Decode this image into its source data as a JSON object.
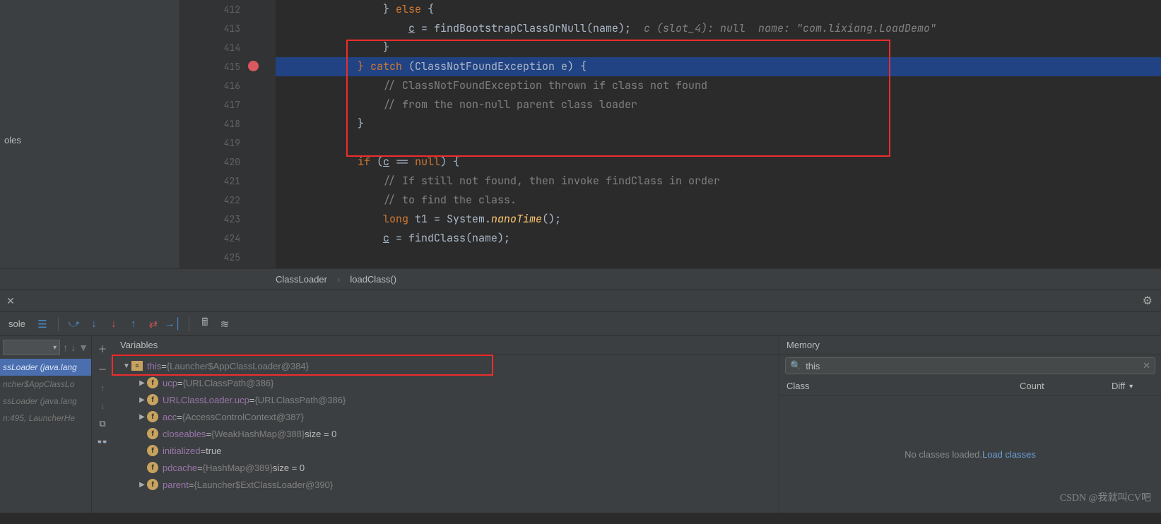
{
  "sidebar": {
    "item": "oles"
  },
  "code": {
    "lines": [
      {
        "n": 412,
        "indent": "                ",
        "tokens": [
          {
            "t": "} ",
            "c": "var"
          },
          {
            "t": "else ",
            "c": "kw"
          },
          {
            "t": "{",
            "c": "var"
          }
        ]
      },
      {
        "n": 413,
        "indent": "                    ",
        "tokens": [
          {
            "t": "c",
            "c": "var underline"
          },
          {
            "t": " = findBootstrapClassOrNull(name);  ",
            "c": "var"
          },
          {
            "t": "c (slot_4): null  name: \"com.lixiang.LoadDemo\"",
            "c": "ide-hint"
          }
        ]
      },
      {
        "n": 414,
        "indent": "                ",
        "tokens": [
          {
            "t": "}",
            "c": "var"
          }
        ]
      },
      {
        "n": 415,
        "indent": "            ",
        "hl": true,
        "bp": true,
        "tokens": [
          {
            "t": "} ",
            "c": "kw"
          },
          {
            "t": "catch ",
            "c": "kw"
          },
          {
            "t": "(ClassNotFoundException e) {",
            "c": "var"
          }
        ]
      },
      {
        "n": 416,
        "indent": "                ",
        "tokens": [
          {
            "t": "// ClassNotFoundException thrown if class not found",
            "c": "cmt"
          }
        ]
      },
      {
        "n": 417,
        "indent": "                ",
        "tokens": [
          {
            "t": "// from the non-null parent class loader",
            "c": "cmt"
          }
        ]
      },
      {
        "n": 418,
        "indent": "            ",
        "tokens": [
          {
            "t": "}",
            "c": "var"
          }
        ]
      },
      {
        "n": 419,
        "indent": "",
        "tokens": []
      },
      {
        "n": 420,
        "indent": "            ",
        "tokens": [
          {
            "t": "if ",
            "c": "kw"
          },
          {
            "t": "(",
            "c": "var"
          },
          {
            "t": "c",
            "c": "var underline"
          },
          {
            "t": " == ",
            "c": "var"
          },
          {
            "t": "null",
            "c": "kw"
          },
          {
            "t": ") {",
            "c": "var"
          }
        ]
      },
      {
        "n": 421,
        "indent": "                ",
        "tokens": [
          {
            "t": "// If still not found, then invoke findClass in order",
            "c": "cmt"
          }
        ]
      },
      {
        "n": 422,
        "indent": "                ",
        "tokens": [
          {
            "t": "// to find the class.",
            "c": "cmt"
          }
        ]
      },
      {
        "n": 423,
        "indent": "                ",
        "tokens": [
          {
            "t": "long ",
            "c": "kw"
          },
          {
            "t": "t1 = System.",
            "c": "var"
          },
          {
            "t": "nanoTime",
            "c": "fn"
          },
          {
            "t": "();",
            "c": "var"
          }
        ]
      },
      {
        "n": 424,
        "indent": "                ",
        "tokens": [
          {
            "t": "c",
            "c": "var underline"
          },
          {
            "t": " = findClass(name);",
            "c": "var"
          }
        ]
      },
      {
        "n": 425,
        "indent": "",
        "tokens": []
      }
    ]
  },
  "breadcrumb": {
    "a": "ClassLoader",
    "b": "loadClass()"
  },
  "toolbar": {
    "console": "sole"
  },
  "frames": [
    {
      "t": "ssLoader (java.lang",
      "sel": true
    },
    {
      "t": "ncher$AppClassLo",
      "sel": false
    },
    {
      "t": "ssLoader (java.lang",
      "sel": false
    },
    {
      "t": "n:495, LauncherHe",
      "sel": false
    }
  ],
  "variables": {
    "title": "Variables",
    "rows": [
      {
        "d": 0,
        "arrow": "▼",
        "ic": "obj",
        "name": "this",
        "eq": " = ",
        "val": "{Launcher$AppClassLoader@384}",
        "purple": true
      },
      {
        "d": 1,
        "arrow": "▶",
        "ic": "f",
        "name": "ucp",
        "eq": " = ",
        "val": "{URLClassPath@386}",
        "purple": true
      },
      {
        "d": 1,
        "arrow": "▶",
        "ic": "f",
        "name": "URLClassLoader.ucp",
        "eq": " = ",
        "val": "{URLClassPath@386}",
        "purple": true
      },
      {
        "d": 1,
        "arrow": "▶",
        "ic": "f",
        "name": "acc",
        "eq": " = ",
        "val": "{AccessControlContext@387}",
        "purple": true
      },
      {
        "d": 1,
        "arrow": "",
        "ic": "f",
        "name": "closeables",
        "eq": " = ",
        "val": "{WeakHashMap@388}",
        "extra": "  size = 0",
        "purple": true
      },
      {
        "d": 1,
        "arrow": "",
        "ic": "f",
        "name": "initialized",
        "eq": " = ",
        "val": "true",
        "purple": true,
        "plain": true
      },
      {
        "d": 1,
        "arrow": "",
        "ic": "f",
        "name": "pdcache",
        "eq": " = ",
        "val": "{HashMap@389}",
        "extra": "  size = 0",
        "purple": true
      },
      {
        "d": 1,
        "arrow": "▶",
        "ic": "f",
        "name": "parent",
        "eq": " = ",
        "val": "{Launcher$ExtClassLoader@390}",
        "purple": true
      }
    ]
  },
  "memory": {
    "title": "Memory",
    "search": "this",
    "cols": {
      "c1": "Class",
      "c2": "Count",
      "c3": "Diff"
    },
    "empty_a": "No classes loaded. ",
    "empty_b": "Load classes"
  },
  "watermark": "CSDN @我就叫CV吧"
}
